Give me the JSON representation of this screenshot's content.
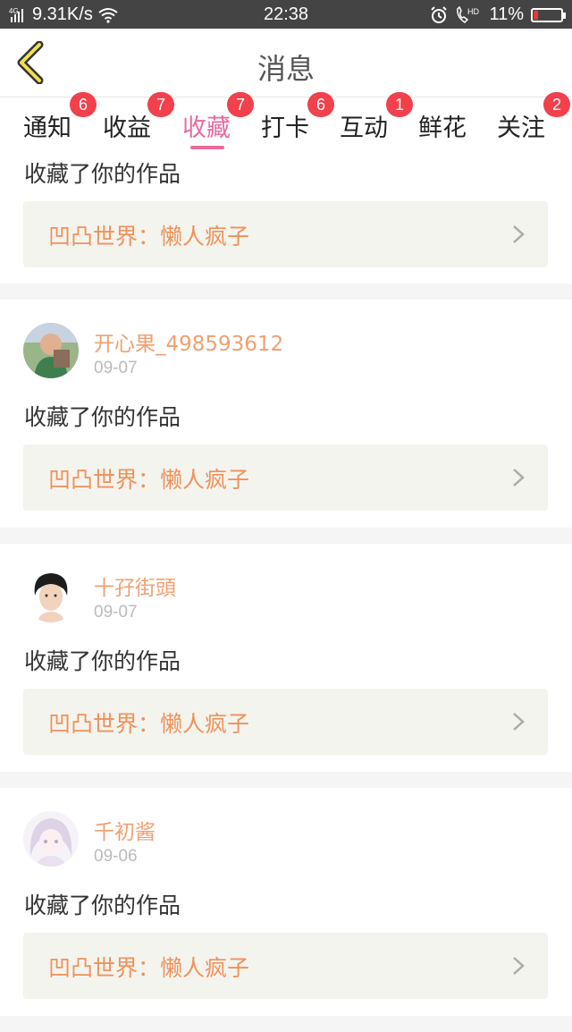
{
  "status_bar": {
    "network": "4G",
    "speed": "9.31K/s",
    "time": "22:38",
    "hd_label": "HD",
    "battery": "11%"
  },
  "nav": {
    "title": "消息",
    "back_icon": "chevron-left-icon"
  },
  "tabs": [
    {
      "label": "通知",
      "badge": "6"
    },
    {
      "label": "收益",
      "badge": "7"
    },
    {
      "label": "收藏",
      "badge": "7",
      "active": true
    },
    {
      "label": "打卡",
      "badge": "6"
    },
    {
      "label": "互动",
      "badge": "1"
    },
    {
      "label": "鲜花",
      "badge": ""
    },
    {
      "label": "关注",
      "badge": "2"
    }
  ],
  "messages": [
    {
      "text": "收藏了你的作品",
      "work": "凹凸世界：懒人疯子"
    },
    {
      "user": "开心果_498593612",
      "date": "09-07",
      "text": "收藏了你的作品",
      "work": "凹凸世界：懒人疯子"
    },
    {
      "user": "十孖街頭",
      "date": "09-07",
      "text": "收藏了你的作品",
      "work": "凹凸世界：懒人疯子"
    },
    {
      "user": "千初酱",
      "date": "09-06",
      "text": "收藏了你的作品",
      "work": "凹凸世界：懒人疯子"
    }
  ],
  "colors": {
    "accent": "#e86aa0",
    "badge": "#f2404c",
    "username": "#f0a070",
    "work_title": "#f0915a"
  }
}
